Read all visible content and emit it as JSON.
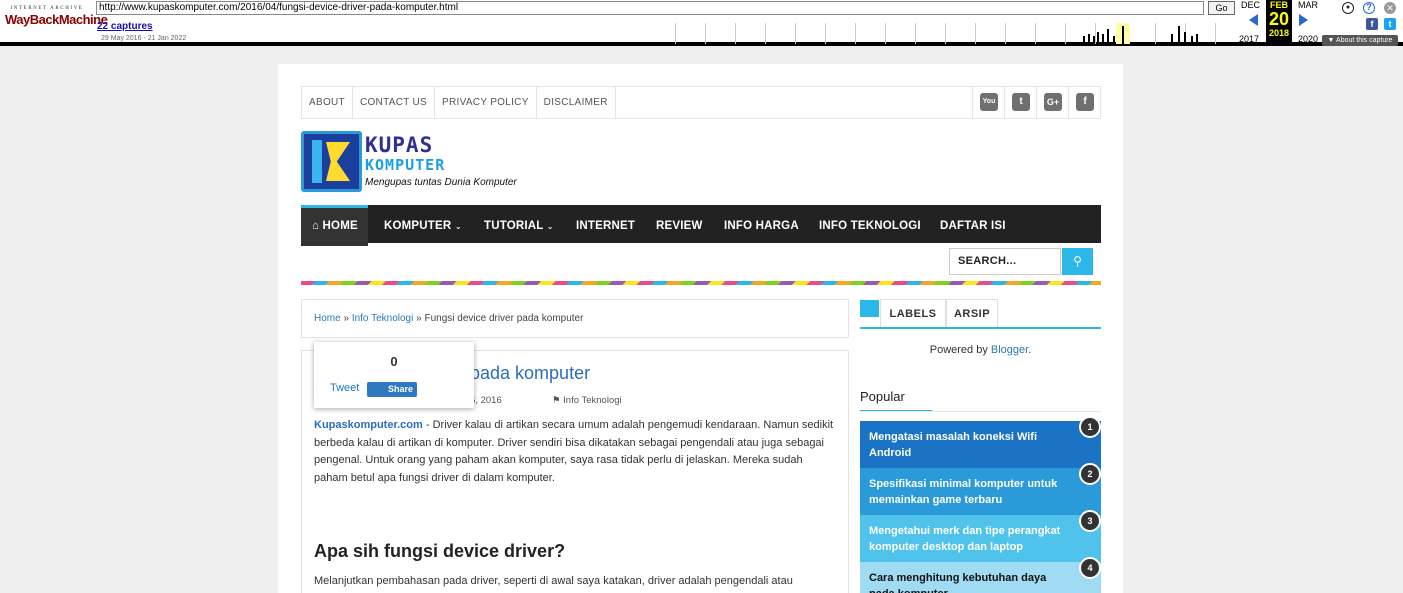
{
  "wayback": {
    "logo_top": "INTERNET ARCHIVE",
    "logo_main": "WayBackMachine",
    "url": "http://www.kupaskomputer.com/2016/04/fungsi-device-driver-pada-komputer.html",
    "go_label": "Go",
    "captures": "22 captures",
    "range": "29 May 2016 - 21 Jan 2022",
    "prev_month": "DEC",
    "cur_month": "FEB",
    "next_month": "MAR",
    "cur_day": "20",
    "prev_year": "2017",
    "cur_year": "2018",
    "next_year": "2020",
    "about": "About this capture"
  },
  "toplinks": [
    "ABOUT",
    "CONTACT US",
    "PRIVACY POLICY",
    "DISCLAIMER"
  ],
  "social": [
    {
      "icon": "youtube-icon",
      "glyph": "You"
    },
    {
      "icon": "twitter-icon",
      "glyph": "t"
    },
    {
      "icon": "google-plus-icon",
      "glyph": "G+"
    },
    {
      "icon": "facebook-icon",
      "glyph": "f"
    }
  ],
  "logo": {
    "line1": "KUPAS",
    "line2": "KOMPUTER",
    "tagline": "Mengupas tuntas Dunia Komputer"
  },
  "nav": {
    "home": "HOME",
    "komputer": "KOMPUTER",
    "tutorial": "TUTORIAL",
    "internet": "INTERNET",
    "review": "REVIEW",
    "info_harga": "INFO HARGA",
    "info_teknologi": "INFO TEKNOLOGI",
    "daftar_isi": "DAFTAR ISI"
  },
  "search": {
    "placeholder": "SEARCH..."
  },
  "breadcrumb": {
    "home": "Home",
    "sep1": " » ",
    "category": "Info Teknologi",
    "sep2": " » ",
    "current": "Fungsi device driver pada komputer"
  },
  "post": {
    "title_visible": "pada komputer",
    "date_visible": "l 26, 2016",
    "category": "Info Teknologi",
    "site_name": "Kupaskomputer.com",
    "intro": " - Driver kalau di artikan secara umum adalah pengemudi kendaraan. Namun sedikit berbeda kalau di artikan di komputer. Driver sendiri bisa dikatakan sebagai pengendali atau juga sebagai pengenal. Untuk orang yang paham akan komputer, saya rasa tidak perlu di jelaskan. Mereka sudah paham betul apa fungsi driver di dalam komputer.",
    "heading": "Apa sih fungsi device driver?",
    "para2": "Melanjutkan pembahasan pada driver, seperti di awal saya katakan, driver adalah pengendali atau"
  },
  "share": {
    "count": "0",
    "tweet": "Tweet",
    "share": "Share"
  },
  "sidebar": {
    "tab_labels": "LABELS",
    "tab_arsip": "ARSIP",
    "powered_prefix": "Powered by ",
    "powered_link": "Blogger",
    "powered_suffix": ".",
    "popular_title": "Popular",
    "popular": [
      {
        "num": "1",
        "title": "Mengatasi masalah koneksi Wifi Android",
        "color": "#1b73c6"
      },
      {
        "num": "2",
        "title": "Spesifikasi minimal komputer untuk memainkan game terbaru",
        "color": "#2a9ad9"
      },
      {
        "num": "3",
        "title": "Mengetahui merk dan tipe perangkat komputer desktop dan laptop",
        "color": "#4fc3ec"
      },
      {
        "num": "4",
        "title": "Cara menghitung kebutuhan daya pada komputer",
        "color": "#9fdcf4"
      }
    ]
  }
}
